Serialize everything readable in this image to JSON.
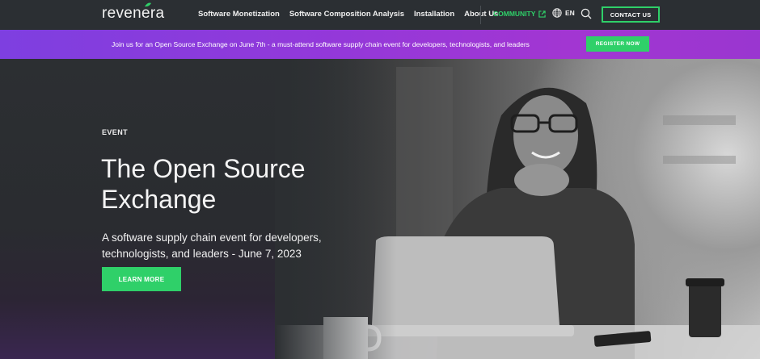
{
  "brand": {
    "logo_text": "revenera"
  },
  "nav": {
    "links": [
      "Software Monetization",
      "Software Composition Analysis",
      "Installation",
      "About Us"
    ],
    "community": "COMMUNITY",
    "language": "EN",
    "contact": "CONTACT US"
  },
  "announcement": {
    "text": "Join us for an Open Source Exchange on June 7th - a must-attend software supply chain event for developers, technologists, and leaders",
    "button": "REGISTER NOW"
  },
  "hero": {
    "eyebrow": "EVENT",
    "title": "The Open Source Exchange",
    "subtitle": "A software supply chain event for developers, technologists, and leaders - June 7, 2023",
    "cta": "LEARN MORE"
  },
  "colors": {
    "accent_green": "#2fd069",
    "nav_bg": "#2b2f33",
    "banner_purple": "#9438d9"
  }
}
